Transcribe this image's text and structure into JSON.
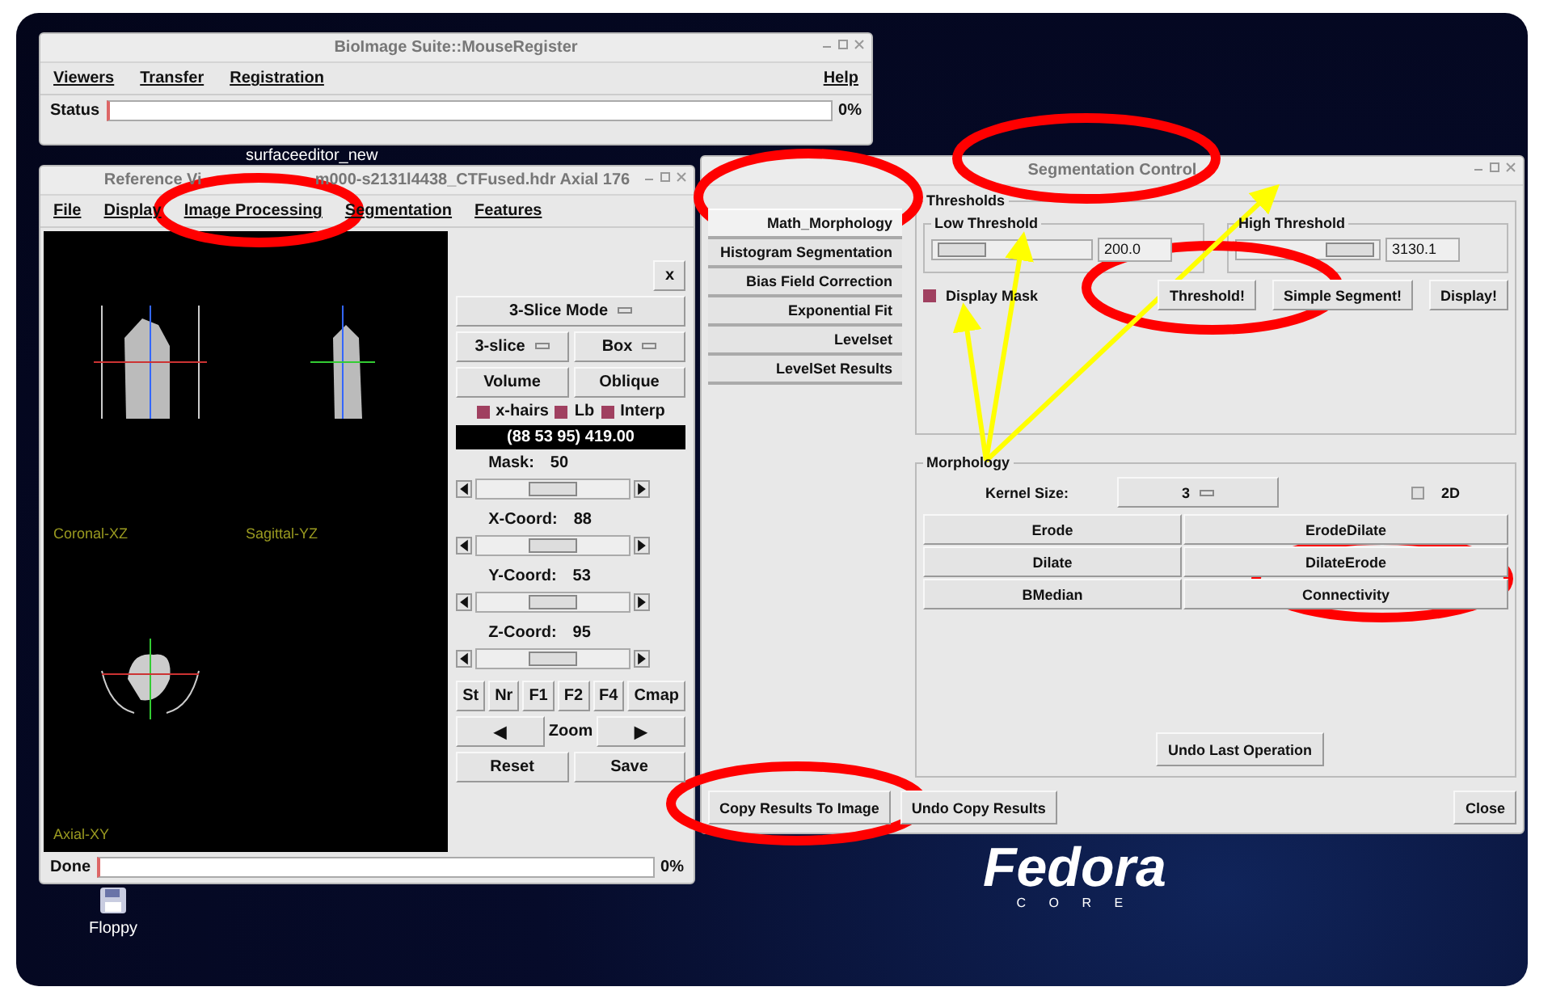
{
  "main_window": {
    "title": "BioImage Suite::MouseRegister",
    "menu": [
      {
        "label": "Viewers"
      },
      {
        "label": "Transfer"
      },
      {
        "label": "Registration"
      }
    ],
    "help": "Help",
    "status_label": "Status",
    "status_percent": "0%",
    "level": 0
  },
  "desktop_label": "surfaceeditor_new",
  "viewer": {
    "title": "Reference Vi",
    "title_tail": "m000-s2131l4438_CTFused.hdr Axial 176",
    "menu": [
      {
        "label": "File"
      },
      {
        "label": "Display"
      },
      {
        "label": "Image Processing"
      },
      {
        "label": "Segmentation"
      },
      {
        "label": "Features"
      }
    ],
    "views": [
      {
        "label": "Coronal-XZ",
        "kind": "coronal"
      },
      {
        "label": "Sagittal-YZ",
        "kind": "sagittal"
      },
      {
        "label": "Axial-XY",
        "kind": "axial"
      }
    ],
    "close": "x",
    "mode": "3-Slice Mode",
    "dropdowns": [
      {
        "label": "3-slice"
      },
      {
        "label": "Box"
      }
    ],
    "buttons": [
      {
        "label": "Volume"
      },
      {
        "label": "Oblique"
      }
    ],
    "toggles": [
      {
        "label": "x-hairs",
        "checked": true
      },
      {
        "label": "Lb",
        "checked": true
      },
      {
        "label": "Interp",
        "checked": true
      }
    ],
    "readout": "(88 53 95) 419.00",
    "sliders": [
      {
        "label": "Mask:",
        "value": "50",
        "level": 0.5
      },
      {
        "label": "X-Coord:",
        "value": "88",
        "level": 0.5
      },
      {
        "label": "Y-Coord:",
        "value": "53",
        "level": 0.5
      },
      {
        "label": "Z-Coord:",
        "value": "95",
        "level": 0.5
      }
    ],
    "small_buttons": [
      {
        "label": "St"
      },
      {
        "label": "Nr"
      },
      {
        "label": "F1"
      },
      {
        "label": "F2"
      },
      {
        "label": "F4"
      },
      {
        "label": "Cmap"
      }
    ],
    "zoom": {
      "left": "◀",
      "label": "Zoom",
      "right": "▶"
    },
    "actions": [
      {
        "label": "Reset"
      },
      {
        "label": "Save"
      }
    ],
    "status_label": "Done",
    "status_percent": "0%",
    "level": 0
  },
  "segmentation": {
    "title": "Segmentation Control",
    "tabs": [
      {
        "label": "Math_Morphology",
        "selected": true
      },
      {
        "label": "Histogram Segmentation",
        "selected": false
      },
      {
        "label": "Bias Field Correction",
        "selected": false
      },
      {
        "label": "Exponential Fit",
        "selected": false
      },
      {
        "label": "Levelset",
        "selected": false
      },
      {
        "label": "LevelSet Results",
        "selected": false
      }
    ],
    "thresholds": {
      "title": "Thresholds",
      "low": {
        "label": "Low Threshold",
        "value": "200.0",
        "level": 0.05
      },
      "high": {
        "label": "High Threshold",
        "value": "3130.1",
        "level": 0.95
      },
      "display_mask": {
        "label": "Display Mask",
        "checked": true
      },
      "buttons": [
        {
          "label": "Threshold!"
        },
        {
          "label": "Simple Segment!"
        },
        {
          "label": "Display!"
        }
      ]
    },
    "morphology": {
      "title": "Morphology",
      "kernel_label": "Kernel Size:",
      "kernel_value": "3",
      "two_d": {
        "label": "2D",
        "checked": false
      },
      "buttons": [
        {
          "label": "Erode"
        },
        {
          "label": "ErodeDilate"
        },
        {
          "label": "Dilate"
        },
        {
          "label": "DilateErode"
        },
        {
          "label": "BMedian"
        },
        {
          "label": "Connectivity"
        }
      ],
      "undo": "Undo Last Operation"
    },
    "footer": [
      {
        "label": "Copy Results To Image"
      },
      {
        "label": "Undo Copy Results"
      },
      {
        "label": "Close"
      }
    ]
  },
  "desktop_icons": [
    {
      "label": "Floppy"
    }
  ],
  "logo": {
    "name": "Fedora",
    "tagline": "C O R E"
  }
}
